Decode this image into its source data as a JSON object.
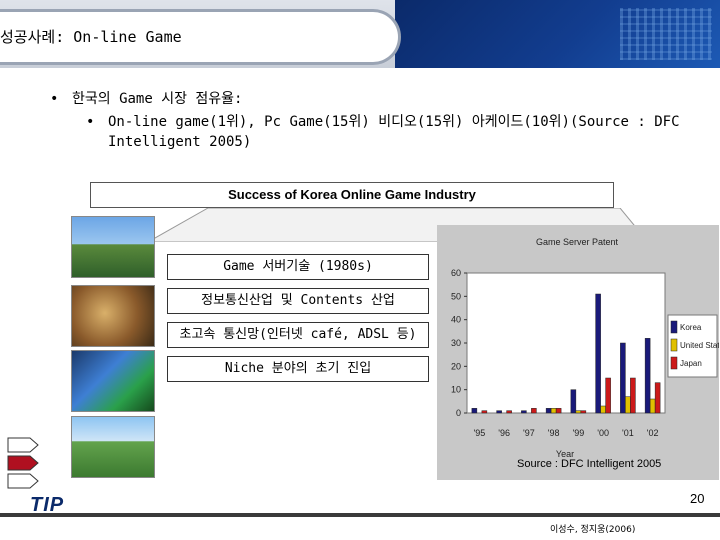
{
  "slide": {
    "title": "성공사례: On-line Game",
    "bullet1": "한국의 Game 시장 점유율:",
    "bullet2": "On-line game(1위), Pc Game(15위) 비디오(15위) 아케이드(10위)(Source : DFC Intelligent 2005)",
    "banner": "Success of Korea Online Game Industry",
    "boxes": [
      "Game 서버기술 (1980s)",
      "정보통신산업 및 Contents 산업",
      "초고속 통신망(인터넷 café, ADSL 등)",
      "Niche 분야의 초기 진입"
    ],
    "caption": "Source : DFC Intelligent 2005",
    "page_number": "20",
    "logo": "TIP",
    "footer_credit": "이성수, 정지웅(2006)"
  },
  "chart_data": {
    "type": "bar",
    "title": "Game Server Patent",
    "xlabel": "Year",
    "ylabel": "",
    "categories": [
      "'95",
      "'96",
      "'97",
      "'98",
      "'99",
      "'00",
      "'01",
      "'02"
    ],
    "ylim": [
      0,
      60
    ],
    "yticks": [
      0,
      10,
      20,
      30,
      40,
      50,
      60
    ],
    "grid": false,
    "legend": "right",
    "series": [
      {
        "name": "Korea",
        "color": "#1a1a7a",
        "values": [
          2,
          1,
          1,
          2,
          10,
          51,
          30,
          32
        ]
      },
      {
        "name": "United States",
        "color": "#e0c000",
        "values": [
          0,
          0,
          0,
          2,
          1,
          3,
          7,
          6
        ]
      },
      {
        "name": "Japan",
        "color": "#cc1a1a",
        "values": [
          1,
          1,
          2,
          2,
          1,
          15,
          15,
          13
        ]
      }
    ]
  }
}
